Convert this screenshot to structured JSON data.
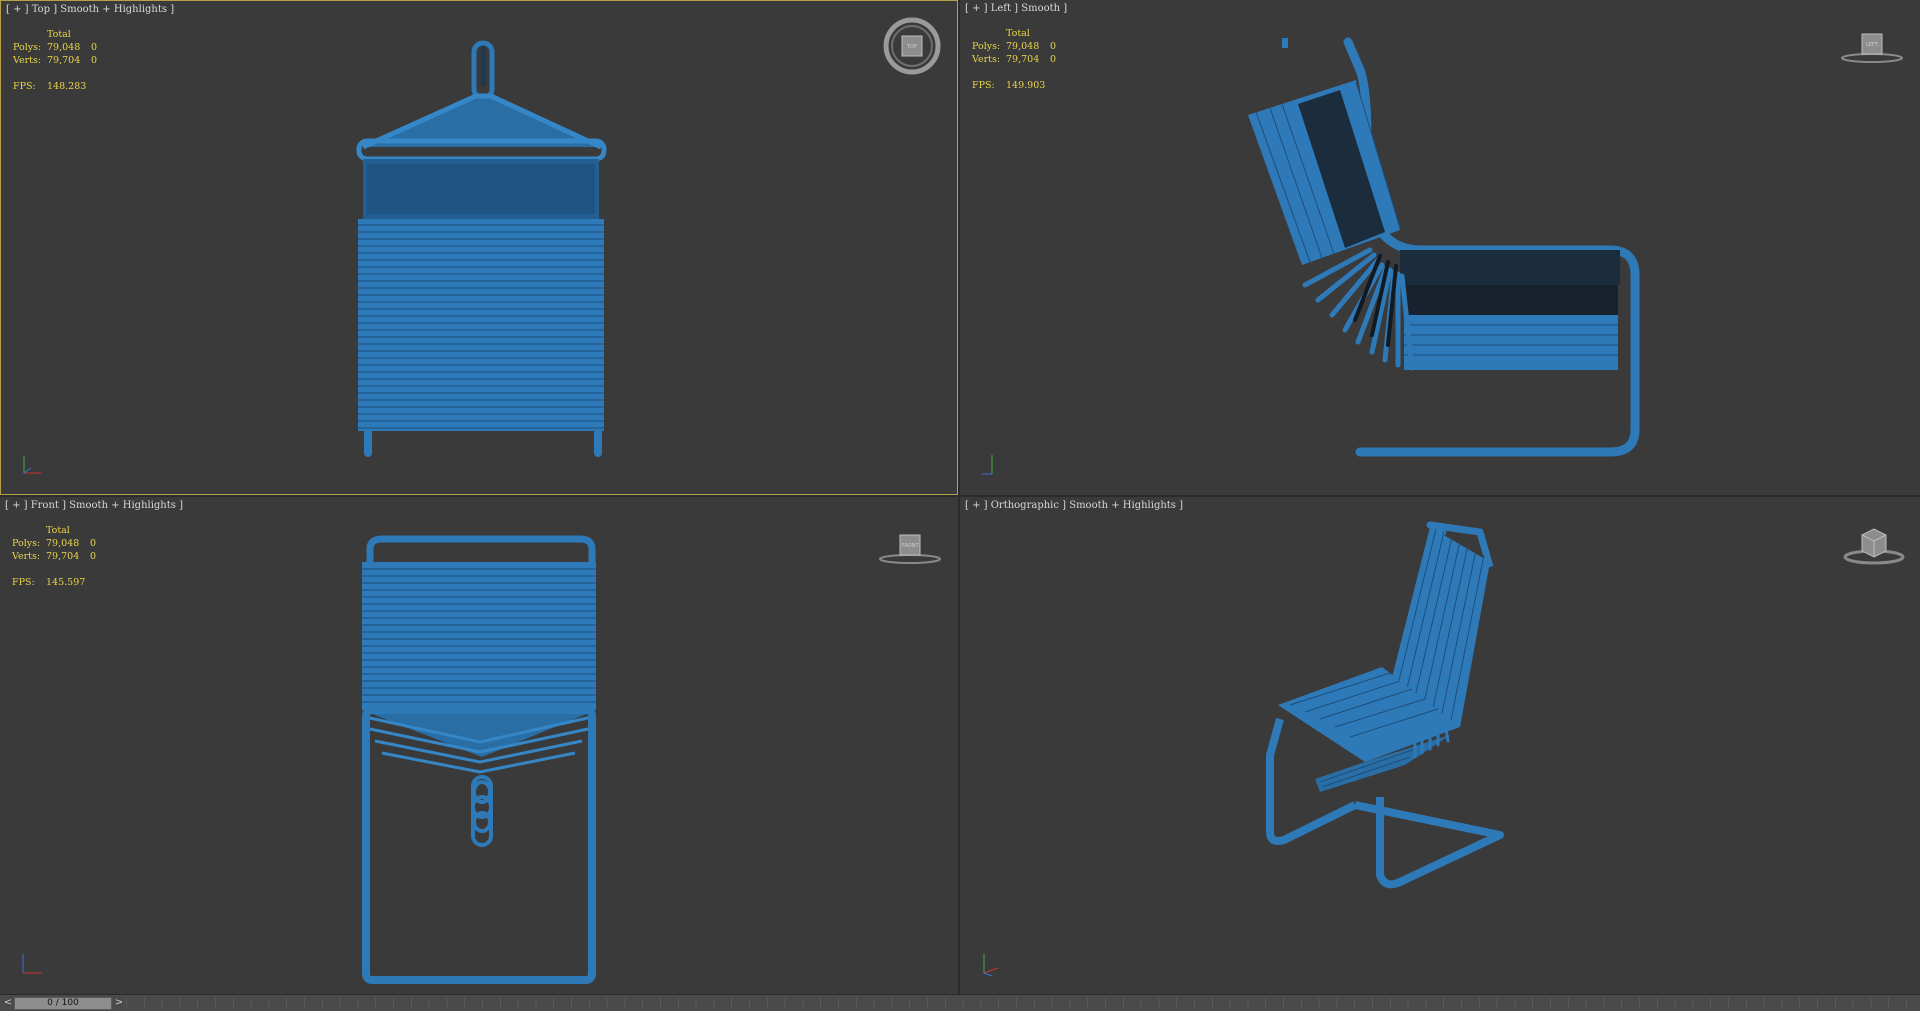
{
  "viewports": {
    "top": {
      "label": "[ + ] Top ] Smooth + Highlights ]",
      "stats_total": "Total",
      "polys_label": "Polys:",
      "polys": "79,048",
      "polys_sel": "0",
      "verts_label": "Verts:",
      "verts": "79,704",
      "verts_sel": "0",
      "fps_label": "FPS:",
      "fps": "148.283",
      "viewcube_label": "TOP"
    },
    "left": {
      "label": "[ + ] Left ] Smooth ]",
      "stats_total": "Total",
      "polys_label": "Polys:",
      "polys": "79,048",
      "polys_sel": "0",
      "verts_label": "Verts:",
      "verts": "79,704",
      "verts_sel": "0",
      "fps_label": "FPS:",
      "fps": "149.903",
      "viewcube_label": "LEFT"
    },
    "front": {
      "label": "[ + ] Front ] Smooth + Highlights ]",
      "stats_total": "Total",
      "polys_label": "Polys:",
      "polys": "79,048",
      "polys_sel": "0",
      "verts_label": "Verts:",
      "verts": "79,704",
      "verts_sel": "0",
      "fps_label": "FPS:",
      "fps": "145.597",
      "viewcube_label": "FRONT"
    },
    "ortho": {
      "label": "[ + ] Orthographic ] Smooth + Highlights ]"
    }
  },
  "timeline": {
    "slider_text": "0 / 100",
    "prev_symbol": "<",
    "next_symbol": ">"
  },
  "colors": {
    "viewport_bg": "#3a3a3a",
    "model": "#2e7ab8",
    "active_border": "#b8a04a",
    "stats_text": "#e8d44a"
  }
}
